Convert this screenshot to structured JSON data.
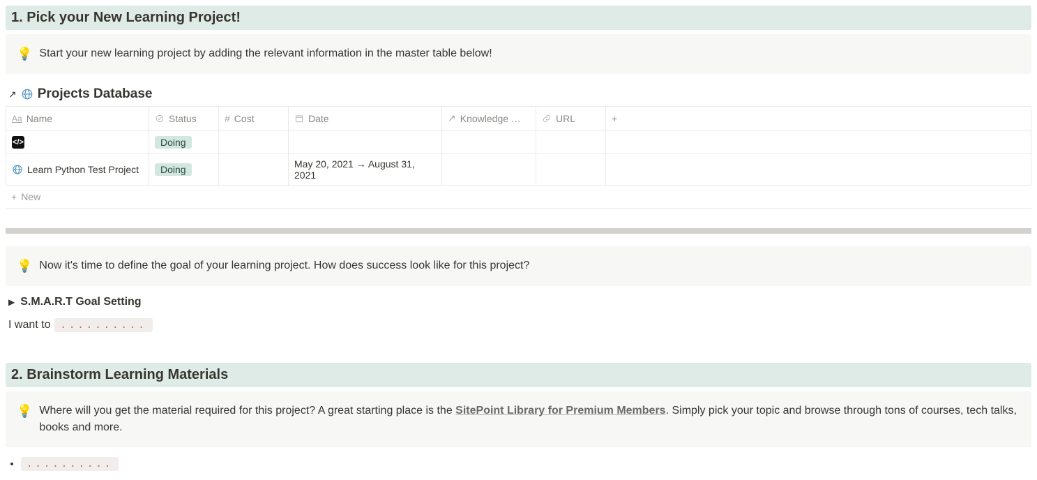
{
  "section1": {
    "heading": "1. Pick your New Learning Project!",
    "callout": "Start your new learning project by adding the relevant information in the master table below!"
  },
  "database": {
    "title": "Projects Database",
    "columns": {
      "name": "Name",
      "status": "Status",
      "cost": "Cost",
      "date": "Date",
      "knowledge": "Knowledge T…",
      "url": "URL"
    },
    "rows": [
      {
        "name": "",
        "status": "Doing",
        "cost": "",
        "date": "",
        "knowledge": "",
        "url": ""
      },
      {
        "name": "Learn Python Test Project",
        "status": "Doing",
        "cost": "",
        "date": "May 20, 2021 → August 31, 2021",
        "knowledge": "",
        "url": ""
      }
    ],
    "new_label": "New"
  },
  "goal": {
    "callout": "Now it's time to define the goal of your learning project. How does success look like for this project?",
    "toggle_label": "S.M.A.R.T Goal Setting",
    "prefix": "I want to",
    "placeholder": ".........."
  },
  "section2": {
    "heading": "2. Brainstorm Learning Materials",
    "callout_before": "Where will you get the material required for this project? A great starting place is the ",
    "callout_link": "SitePoint Library for Premium Members",
    "callout_after": ". Simply pick your topic and browse through tons of courses, tech talks, books and more.",
    "bullet_placeholder": ".........."
  },
  "icons": {
    "bulb": "💡"
  }
}
